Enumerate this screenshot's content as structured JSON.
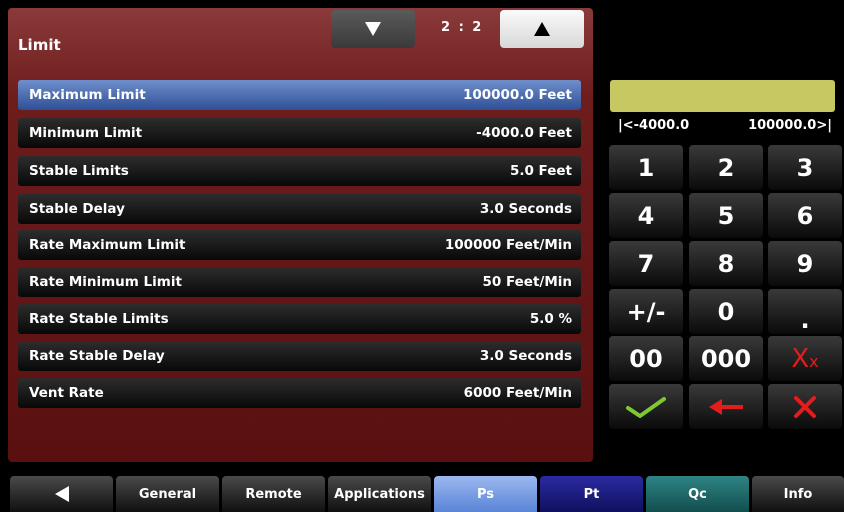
{
  "panel": {
    "title": "Limit",
    "page_indicator": "2 : 2",
    "rows": [
      {
        "label": "Maximum Limit",
        "value": "100000.0 Feet"
      },
      {
        "label": "Minimum Limit",
        "value": "-4000.0 Feet"
      },
      {
        "label": "Stable Limits",
        "value": "5.0 Feet"
      },
      {
        "label": "Stable Delay",
        "value": "3.0 Seconds"
      },
      {
        "label": "Rate Maximum Limit",
        "value": "100000 Feet/Min"
      },
      {
        "label": "Rate Minimum Limit",
        "value": "50 Feet/Min"
      },
      {
        "label": "Rate Stable Limits",
        "value": "5.0 %"
      },
      {
        "label": "Rate Stable Delay",
        "value": "3.0 Seconds"
      },
      {
        "label": "Vent Rate",
        "value": "6000 Feet/Min"
      }
    ],
    "selected_row": "Maximum Limit"
  },
  "keypad": {
    "entry_value": "",
    "range_min": "|<-4000.0",
    "range_max": "100000.0>|",
    "keys": [
      "1",
      "2",
      "3",
      "4",
      "5",
      "6",
      "7",
      "8",
      "9",
      "+/-",
      "0",
      ".",
      "00",
      "000",
      "Xx"
    ],
    "accept_icon": "checkmark-icon",
    "backspace_icon": "left-arrow-icon",
    "cancel_icon": "x-icon"
  },
  "tabs": {
    "back_icon": "back-triangle-icon",
    "items": [
      "General",
      "Remote",
      "Applications",
      "Ps",
      "Pt",
      "Qc",
      "Info"
    ]
  },
  "colors": {
    "panel": "#6e1c1c",
    "selected_row": "#4a6cb0",
    "entry_box": "#c8c862",
    "tab_ps": "#7aa0e6",
    "tab_pt": "#1c1c80",
    "tab_qc": "#1e6b6b",
    "checkmark": "#7ec832",
    "red_icons": "#e41c1c"
  }
}
